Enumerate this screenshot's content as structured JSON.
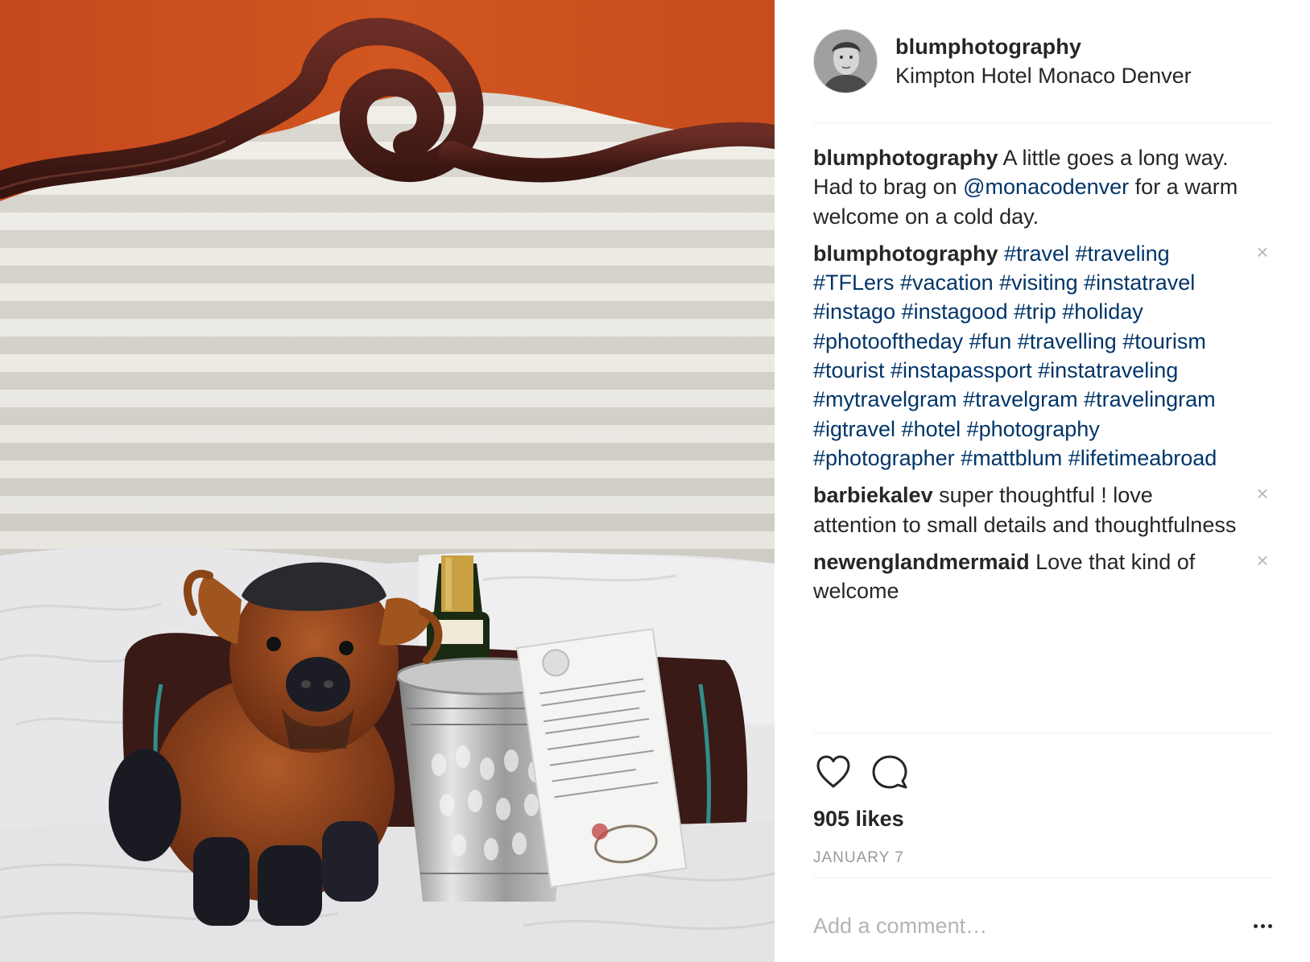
{
  "post": {
    "username": "blumphotography",
    "location": "Kimpton Hotel Monaco Denver",
    "likes": "905 likes",
    "date": "JANUARY 7"
  },
  "caption": {
    "author": "blumphotography",
    "text_before": " A little goes a long way. Had to brag on ",
    "mention": "@monacodenver",
    "text_after": " for a warm welcome on a cold day."
  },
  "comments": [
    {
      "author": "blumphotography",
      "hashtags": "#travel #traveling #TFLers #vacation #visiting #instatravel #instago #instagood #trip #holiday #photooftheday #fun #travelling #tourism #tourist #instapassport #instatraveling #mytravelgram #travelgram #travelingram #igtravel #hotel #photography #photographer #mattblum #lifetimeabroad",
      "remove": "×"
    },
    {
      "author": "barbiekalev",
      "text": "super thoughtful ! love attention to small details and thoughtfulness",
      "remove": "×"
    },
    {
      "author": "newenglandmermaid",
      "text": "Love that kind of welcome",
      "remove": "×"
    }
  ],
  "add_comment": {
    "placeholder": "Add a comment…"
  },
  "icons": {
    "like": "heart-icon",
    "comment": "comment-bubble-icon",
    "more": "more-options-icon"
  },
  "colors": {
    "link": "#003569",
    "text": "#262626",
    "muted": "#999999",
    "headboard_wood": "#4a1c17",
    "wall": "#c5471b"
  }
}
